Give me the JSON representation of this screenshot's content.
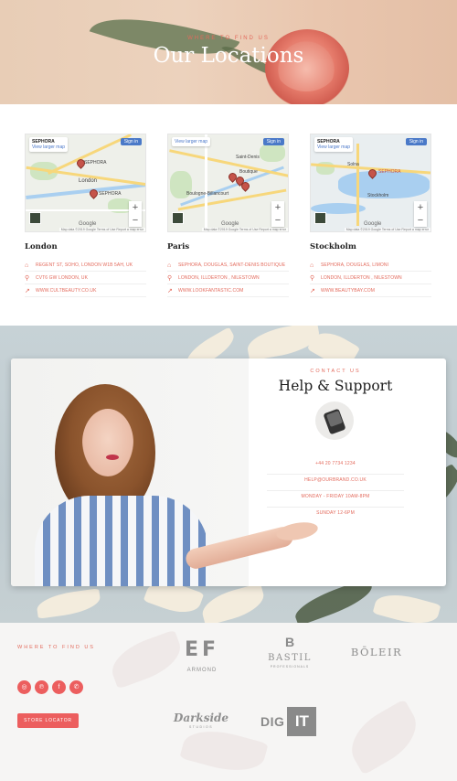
{
  "hero": {
    "eyebrow": "WHERE TO FIND US",
    "title": "Our Locations"
  },
  "locations": [
    {
      "city": "London",
      "map": {
        "place": "SEPHORA",
        "view_larger": "View larger map",
        "sign_in": "Sign in",
        "labels": [
          "SEPHORA",
          "London",
          "SEPHORA"
        ]
      },
      "address": "REGENT ST, SOHO, LONDON W1B 5AH, UK",
      "area": "CVT6 GW LONDON, UK",
      "website": "WWW.CULTBEAUTY.CO.UK"
    },
    {
      "city": "Paris",
      "map": {
        "place": "",
        "view_larger": "View larger map",
        "sign_in": "Sign in",
        "labels": [
          "Saint-Denis",
          "Boutique",
          "Boulogne-Billancourt"
        ]
      },
      "address": "SEPHORA, DOUGLAS, SAINT-DENIS BOUTIQUE",
      "area": "LONDON, ILLDERTON , NILESTOWN",
      "website": "WWW.LOOKFANTASTIC.COM"
    },
    {
      "city": "Stockholm",
      "map": {
        "place": "SEPHORA",
        "view_larger": "View larger map",
        "sign_in": "Sign in",
        "labels": [
          "SEPHORA",
          "Solna",
          "Stockholm"
        ]
      },
      "address": "SEPHORA, DOUGLAS, LIMONI",
      "area": "LONDON, ILLDERTON , NILESTOWN",
      "website": "WWW.BEAUTYBAY.COM"
    }
  ],
  "map_common": {
    "zoom_in": "+",
    "zoom_out": "−",
    "google": "Google",
    "footer": "Map data ©2019 Google  Terms of Use  Report a map error"
  },
  "support": {
    "eyebrow": "CONTACT US",
    "title": "Help & Support",
    "phone": "+44 20 7734 1234",
    "email": "HELP@OURBRAND.CO.UK",
    "hours_weekday": "MONDAY - FRIDAY 10AM-8PM",
    "hours_sunday": "SUNDAY 12-6PM"
  },
  "footer": {
    "eyebrow": "WHERE TO FIND US",
    "socials": [
      {
        "icon": "instagram-icon",
        "glyph": "◎"
      },
      {
        "icon": "pinterest-icon",
        "glyph": "℗"
      },
      {
        "icon": "facebook-icon",
        "glyph": "f"
      },
      {
        "icon": "whatsapp-icon",
        "glyph": "✆"
      }
    ],
    "store_button": "STORE LOCATOR",
    "brands": {
      "armond_mark": "EF",
      "armond": "ARMOND",
      "bastil_mark": "B",
      "bastil": "BASTIL",
      "bastil_sub": "PROFESSIONALS",
      "boleir": "BŌLEIR",
      "darkside": "Darkside",
      "darkside_sub": "STUDIOS",
      "digit_dig": "DIG",
      "digit_it": "IT"
    }
  },
  "colors": {
    "accent": "#e36a5c",
    "button": "#ec5e5e"
  }
}
